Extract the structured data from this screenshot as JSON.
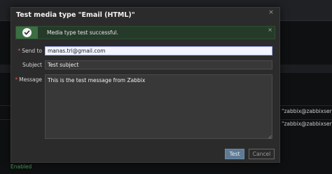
{
  "background": {
    "rows": [
      {
        "text": "\"zabbix@zabbixserver\""
      },
      {
        "text": "\"zabbix@zabbixserver\""
      }
    ],
    "status_link": "Enabled"
  },
  "dialog": {
    "title": "Test media type \"Email (HTML)\"",
    "close_glyph": "×",
    "message": {
      "text": "Media type test successful.",
      "close_glyph": "×"
    },
    "fields": {
      "send_to": {
        "label": "Send to",
        "required": "*",
        "value": "manas.tri@gmail.com"
      },
      "subject": {
        "label": "Subject",
        "value": "Test subject"
      },
      "message": {
        "label": "Message",
        "required": "*",
        "value": "This is the test message from Zabbix"
      }
    },
    "buttons": {
      "test": "Test",
      "cancel": "Cancel"
    }
  }
}
